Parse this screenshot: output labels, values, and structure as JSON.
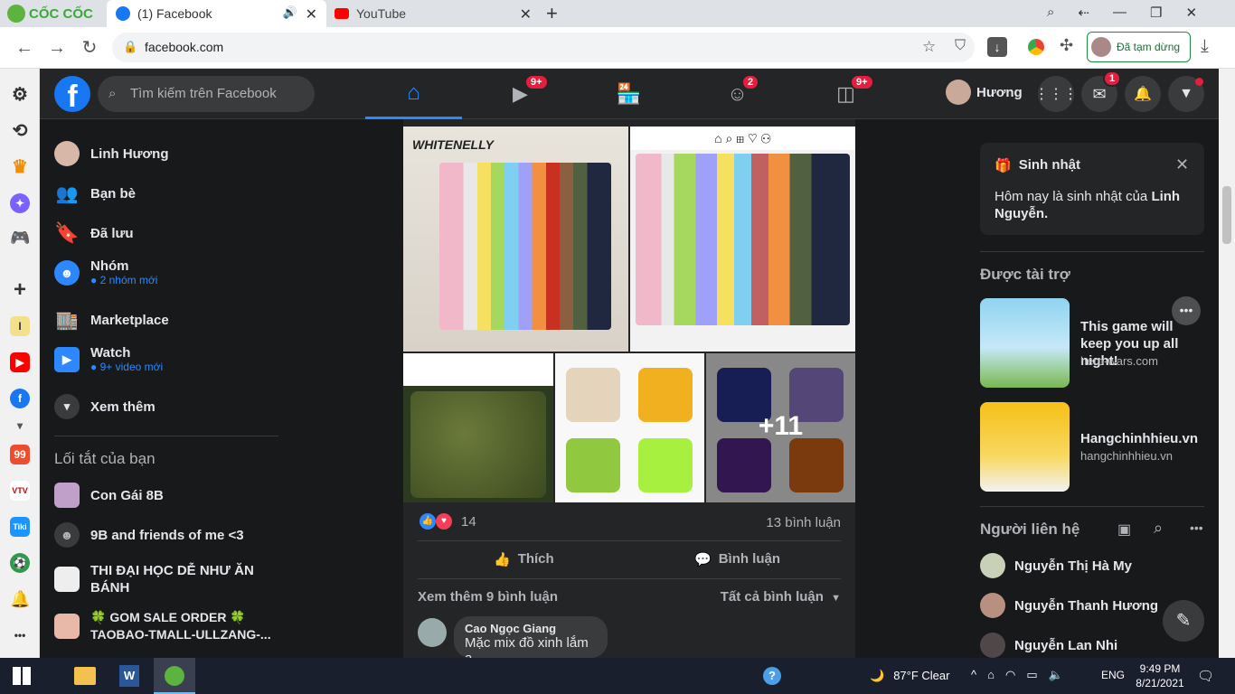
{
  "browser": {
    "brand": "CỐC CỐC",
    "tabs": [
      {
        "title": "(1) Facebook"
      },
      {
        "title": "YouTube"
      }
    ],
    "url": "facebook.com",
    "paused_label": "Đã tạm dừng"
  },
  "fb_header": {
    "search_placeholder": "Tìm kiếm trên Facebook",
    "badges": {
      "watch": "9+",
      "groups": "2",
      "gaming": "9+",
      "messenger": "1"
    },
    "user_name": "Hương"
  },
  "left_nav": {
    "items": [
      {
        "label": "Linh Hương",
        "sub": ""
      },
      {
        "label": "Bạn bè",
        "sub": ""
      },
      {
        "label": "Đã lưu",
        "sub": ""
      },
      {
        "label": "Nhóm",
        "sub": "● 2 nhóm mới"
      },
      {
        "label": "Marketplace",
        "sub": ""
      },
      {
        "label": "Watch",
        "sub": "● 9+ video mới"
      },
      {
        "label": "Xem thêm",
        "sub": ""
      }
    ],
    "shortcuts_title": "Lối tắt của bạn",
    "shortcuts": [
      {
        "label": "Con Gái 8B"
      },
      {
        "label": "9B and friends of me <3"
      },
      {
        "label": "THI ĐẠI HỌC DỄ NHƯ ĂN BÁNH"
      },
      {
        "label": "🍀 GOM SALE ORDER 🍀 TAOBAO-TMALL-ULLZANG-..."
      }
    ]
  },
  "post": {
    "more_photos": "+11",
    "reaction_count": "14",
    "comment_count": "13 bình luận",
    "like_label": "Thích",
    "comment_label": "Bình luận",
    "view_more_comments": "Xem thêm 9 bình luận",
    "all_comments": "Tất cả bình luận",
    "comment": {
      "author": "Cao Ngọc Giang",
      "text": "Mặc mix đồ xinh lắm ạ"
    }
  },
  "right_col": {
    "birthday_title": "Sinh nhật",
    "birthday_text_prefix": "Hôm nay là sinh nhật của ",
    "birthday_name": "Linh Nguyễn.",
    "sponsored_title": "Được tài trợ",
    "ads": [
      {
        "title": "This game will keep you up all night!",
        "domain": "hero-wars.com"
      },
      {
        "title": "Hangchinhhieu.vn",
        "domain": "hangchinhhieu.vn"
      }
    ],
    "contacts_title": "Người liên hệ",
    "contacts": [
      {
        "name": "Nguyễn Thị Hà My"
      },
      {
        "name": "Nguyễn Thanh Hương"
      },
      {
        "name": "Nguyễn Lan Nhi"
      }
    ]
  },
  "taskbar": {
    "weather": "87°F  Clear",
    "lang": "ENG",
    "time": "9:49 PM",
    "date": "8/21/2021"
  }
}
